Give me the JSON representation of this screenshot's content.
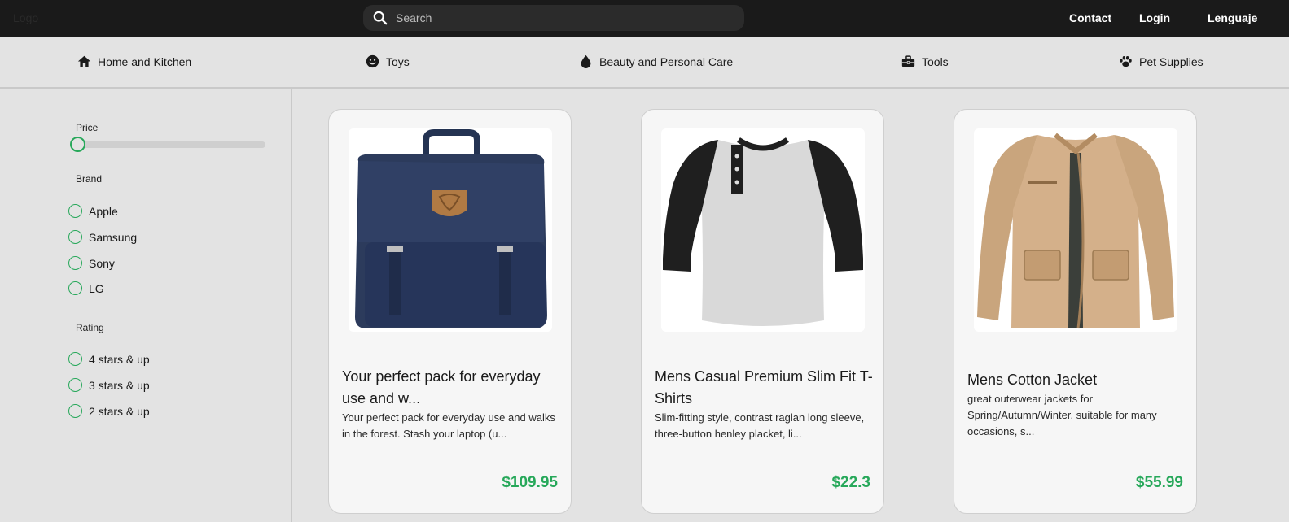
{
  "header": {
    "logo": "Logo",
    "search_placeholder": "Search",
    "links": {
      "contact": "Contact",
      "login": "Login",
      "language": "Lenguaje"
    }
  },
  "categories": [
    {
      "label": "Home and Kitchen",
      "icon": "home-icon"
    },
    {
      "label": "Toys",
      "icon": "smile-icon"
    },
    {
      "label": "Beauty and Personal Care",
      "icon": "drop-icon"
    },
    {
      "label": "Tools",
      "icon": "toolbox-icon"
    },
    {
      "label": "Pet Supplies",
      "icon": "paw-icon"
    }
  ],
  "filters": {
    "price_title": "Price",
    "price_value": 0,
    "brand_title": "Brand",
    "brands": [
      "Apple",
      "Samsung",
      "Sony",
      "LG"
    ],
    "rating_title": "Rating",
    "ratings": [
      "4 stars & up",
      "3 stars & up",
      "2 stars & up"
    ]
  },
  "products": [
    {
      "title": "Your perfect pack for everyday use and w...",
      "description": "Your perfect pack for everyday use and walks in the forest. Stash your laptop (u...",
      "price": "$109.95"
    },
    {
      "title": "Mens Casual Premium Slim Fit T-Shirts",
      "description": "Slim-fitting style, contrast raglan long sleeve, three-button henley placket, li...",
      "price": "$22.3"
    },
    {
      "title": "Mens Cotton Jacket",
      "description": "great outerwear jackets for Spring/Autumn/Winter, suitable for many occasions, s...",
      "price": "$55.99"
    }
  ],
  "colors": {
    "accent": "#27a85a",
    "topbar": "#1a1a1a",
    "background": "#e3e3e3"
  }
}
